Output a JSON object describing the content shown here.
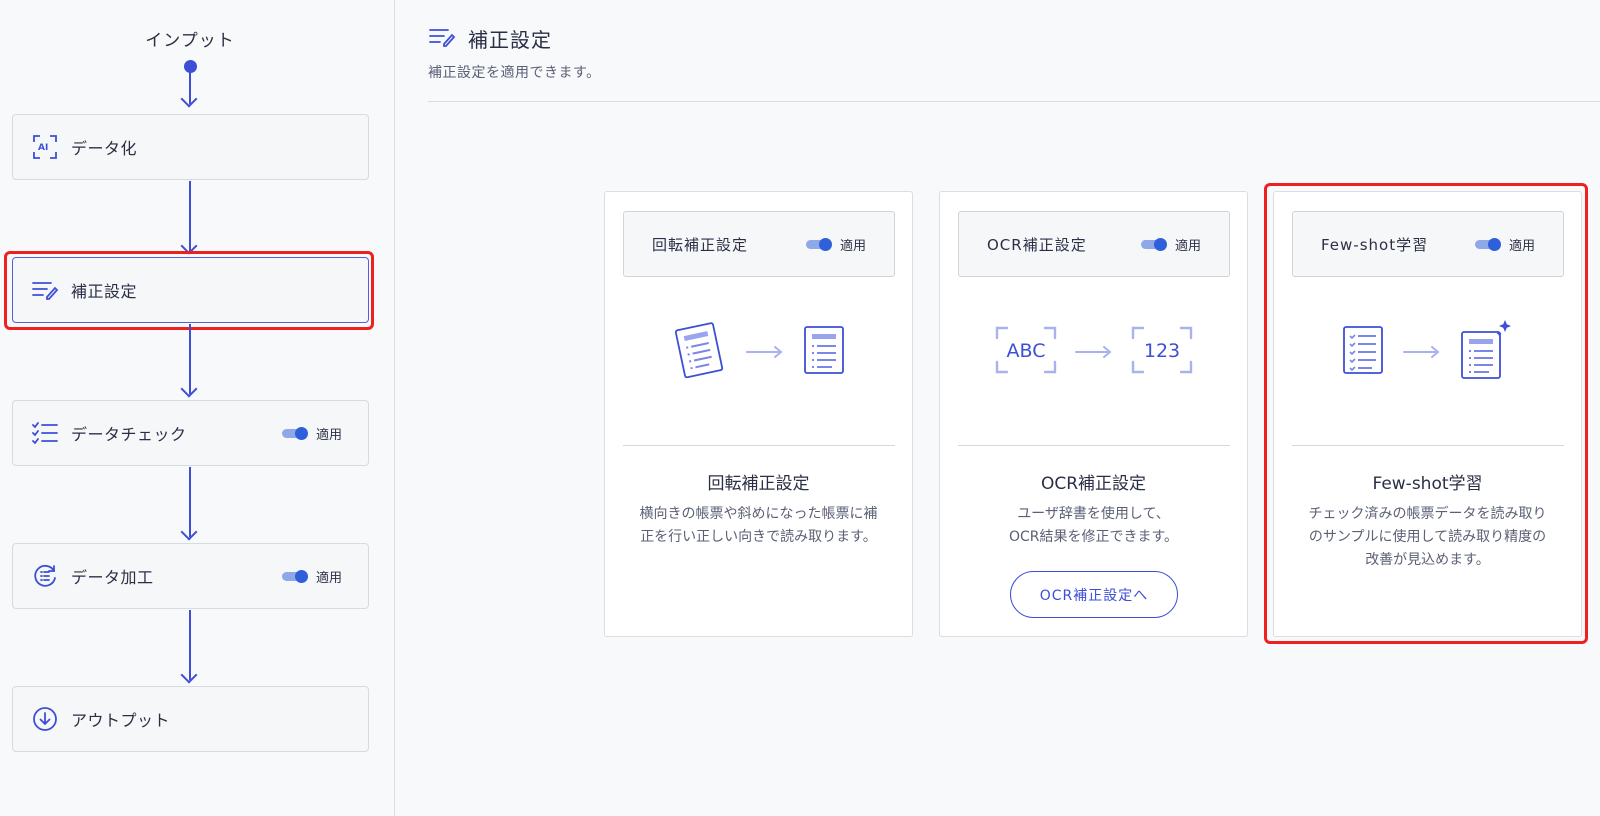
{
  "flow": {
    "input_label": "インプット",
    "steps": [
      {
        "label": "データ化",
        "icon": "ai-scan-icon",
        "toggle": null
      },
      {
        "label": "補正設定",
        "icon": "edit-lines-icon",
        "toggle": null,
        "active": true
      },
      {
        "label": "データチェック",
        "icon": "checklist-icon",
        "toggle": "適用"
      },
      {
        "label": "データ加工",
        "icon": "process-list-icon",
        "toggle": "適用"
      },
      {
        "label": "アウトプット",
        "icon": "download-circle-icon",
        "toggle": null
      }
    ]
  },
  "main": {
    "title": "補正設定",
    "subtitle": "補正設定を適用できます。",
    "cards": [
      {
        "header": "回転補正設定",
        "toggle": "適用",
        "title": "回転補正設定",
        "description_lines": [
          "横向きの帳票や斜めになった帳票に補",
          "正を行い正しい向きで読み取ります。"
        ],
        "icons": [
          "rotated-document-icon",
          "arrow-right-icon",
          "document-icon"
        ]
      },
      {
        "header": "OCR補正設定",
        "toggle": "適用",
        "title": "OCR補正設定",
        "description_lines": [
          "ユーザ辞書を使用して、",
          "OCR結果を修正できます。"
        ],
        "button": "OCR補正設定へ",
        "illus_text_left": "ABC",
        "illus_text_right": "123",
        "icons": [
          "abc-scan-icon",
          "arrow-right-icon",
          "number-scan-icon"
        ]
      },
      {
        "header": "Few-shot学習",
        "toggle": "適用",
        "title": "Few-shot学習",
        "description_lines": [
          "チェック済みの帳票データを読み取り",
          "のサンプルに使用して読み取り精度の",
          "改善が見込めます。"
        ],
        "icons": [
          "checked-document-icon",
          "arrow-right-icon",
          "sparkle-document-icon"
        ]
      }
    ]
  },
  "colors": {
    "accent": "#3d4fd6",
    "highlight": "#ee2020",
    "toggle_on": "#2f5fd9"
  }
}
